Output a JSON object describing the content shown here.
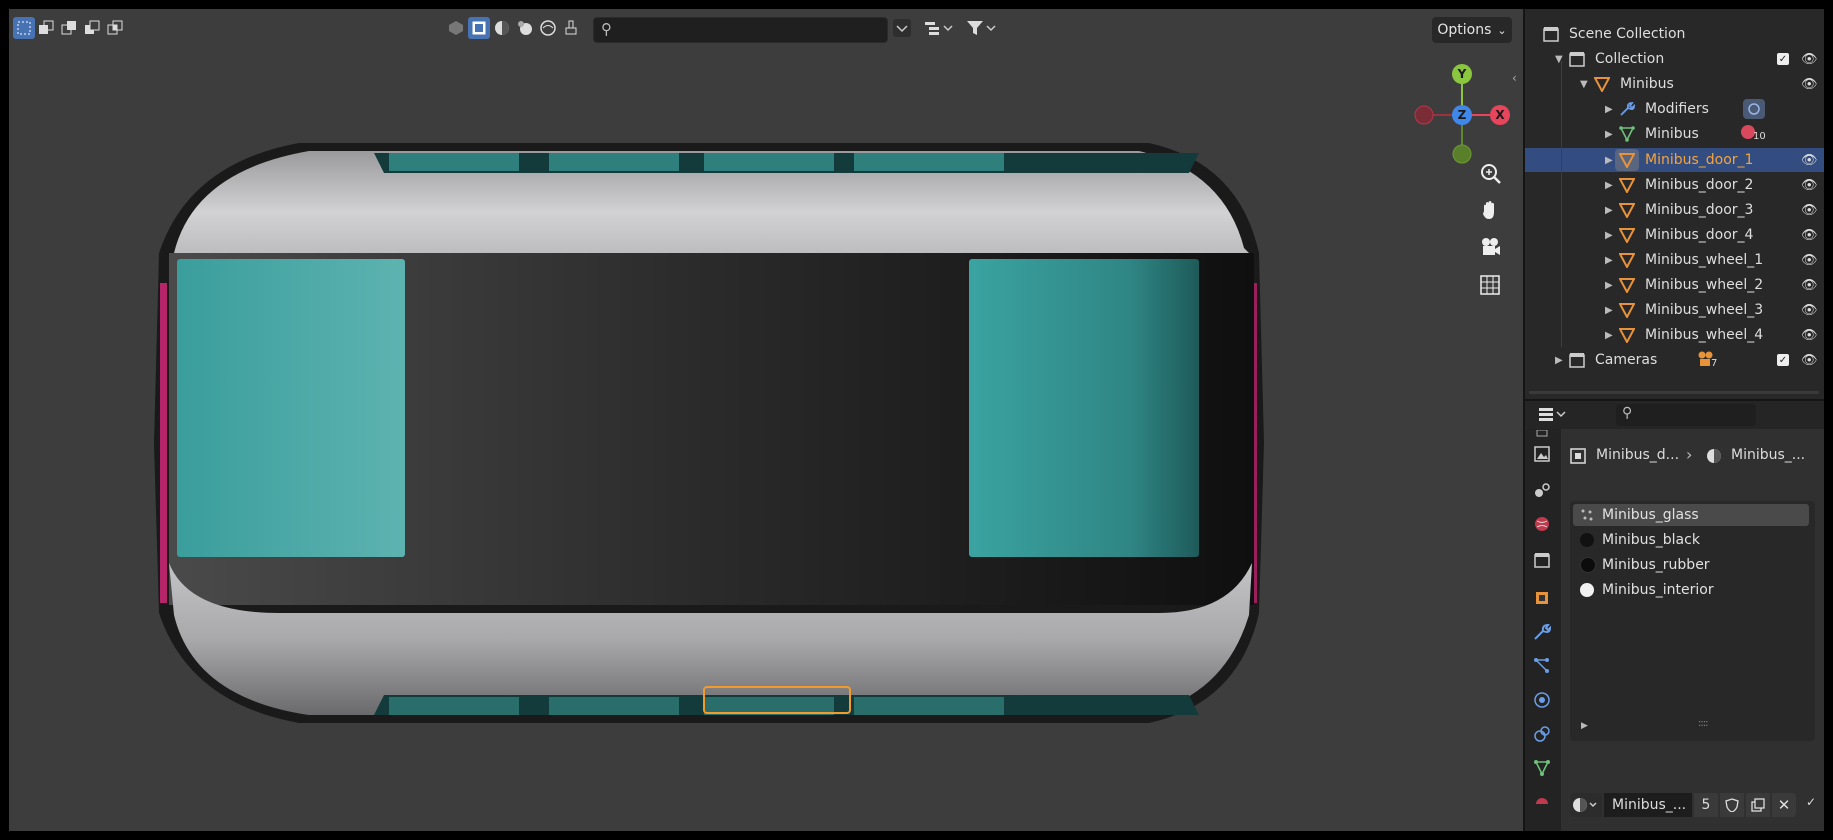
{
  "viewport": {
    "header": {
      "options_label": "Options",
      "search_placeholder": ""
    }
  },
  "gizmo": {
    "x_label": "X",
    "y_label": "Y",
    "z_label": "Z"
  },
  "outliner": {
    "rows": [
      {
        "label": "Scene Collection"
      },
      {
        "label": "Collection"
      },
      {
        "label": "Minibus"
      },
      {
        "label": "Modifiers"
      },
      {
        "label": "Minibus",
        "badge": "10"
      },
      {
        "label": "Minibus_door_1"
      },
      {
        "label": "Minibus_door_2"
      },
      {
        "label": "Minibus_door_3"
      },
      {
        "label": "Minibus_door_4"
      },
      {
        "label": "Minibus_wheel_1"
      },
      {
        "label": "Minibus_wheel_2"
      },
      {
        "label": "Minibus_wheel_3"
      },
      {
        "label": "Minibus_wheel_4"
      },
      {
        "label": "Cameras",
        "badge": "7"
      }
    ]
  },
  "properties": {
    "search_placeholder": "",
    "breadcrumb": {
      "object": "Minibus_d...",
      "material": "Minibus_..."
    },
    "materials": [
      {
        "name": "Minibus_glass",
        "color": "#c8c8c8"
      },
      {
        "name": "Minibus_black",
        "color": "#111111"
      },
      {
        "name": "Minibus_rubber",
        "color": "#0c0c0c"
      },
      {
        "name": "Minibus_interior",
        "color": "#f2f2f2"
      }
    ],
    "material_field": "Minibus_...",
    "user_count": "5"
  },
  "colors": {
    "accent": "#4772b3",
    "selection_row": "#334d80",
    "object_icon": "#e8923a",
    "active_label": "#f5a33d",
    "glass": "#3aa3a3",
    "body": "#c9c9cb"
  }
}
